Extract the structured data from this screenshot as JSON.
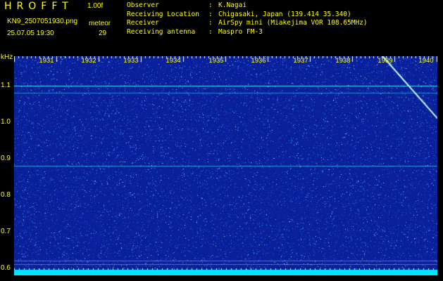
{
  "header": {
    "title": "HROFFT",
    "version": "1.00f",
    "filename": "KN9_2507051930.png",
    "datetime": "25.07.05 19:30",
    "mode": "meteor",
    "count": "29"
  },
  "meta": [
    {
      "key": "Observer",
      "value": "K.Nagai"
    },
    {
      "key": "Receiving Location",
      "value": "Chigasaki, Japan (139.414 35.340)"
    },
    {
      "key": "Receiver",
      "value": "AirSpy mini (Miakejima VOR 108.65MHz)"
    },
    {
      "key": "Receiving antenna",
      "value": "Maspro FM-3"
    }
  ],
  "axis": {
    "unit": "kHz",
    "y_ticks": [
      "1.1",
      "1.0",
      "0.9",
      "0.8",
      "0.7",
      "0.6"
    ],
    "y_range": [
      0.58,
      1.18
    ],
    "x_ticks": [
      "1931",
      "1932",
      "1933",
      "1934",
      "1935",
      "1936",
      "1937",
      "1938",
      "1939",
      "1940"
    ]
  },
  "colors": {
    "background": "#0a1f9a",
    "text": "#ffff00",
    "signal": "#35f0ff",
    "baseline": "#00e5ff"
  },
  "signals": [
    {
      "type": "carrier",
      "freq": 1.1,
      "strength": 0.9
    },
    {
      "type": "carrier",
      "freq": 1.08,
      "strength": 0.5
    },
    {
      "type": "carrier",
      "freq": 0.88,
      "strength": 0.6
    },
    {
      "type": "carrier",
      "freq": 0.62,
      "strength": 0.4
    },
    {
      "type": "carrier",
      "freq": 0.61,
      "strength": 0.4
    },
    {
      "type": "drift",
      "t0": 1939.0,
      "f0": 1.18,
      "t1": 1940.3,
      "f1": 1.01
    }
  ]
}
